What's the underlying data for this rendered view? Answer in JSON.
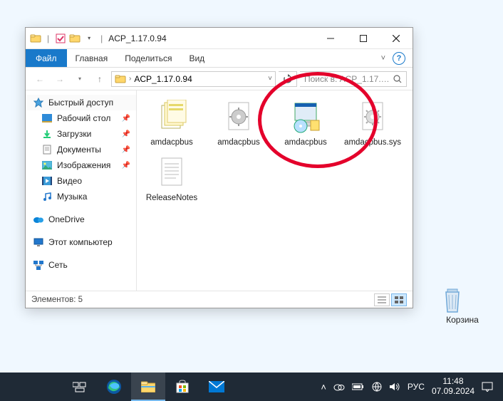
{
  "window": {
    "title": "ACP_1.17.0.94"
  },
  "ribbon": {
    "file": "Файл",
    "tabs": [
      "Главная",
      "Поделиться",
      "Вид"
    ]
  },
  "address": {
    "path_segment": "ACP_1.17.0.94",
    "search_placeholder": "Поиск в: ACP_1.17.0.94"
  },
  "nav": {
    "quick_access": "Быстрый доступ",
    "items": [
      {
        "label": "Рабочий стол",
        "pinned": true
      },
      {
        "label": "Загрузки",
        "pinned": true
      },
      {
        "label": "Документы",
        "pinned": true
      },
      {
        "label": "Изображения",
        "pinned": true
      },
      {
        "label": "Видео",
        "pinned": false
      },
      {
        "label": "Музыка",
        "pinned": false
      }
    ],
    "onedrive": "OneDrive",
    "this_pc": "Этот компьютер",
    "network": "Сеть"
  },
  "files": [
    {
      "name": "amdacpbus",
      "kind": "catalog"
    },
    {
      "name": "amdacpbus",
      "kind": "inf"
    },
    {
      "name": "amdacpbus",
      "kind": "installer"
    },
    {
      "name": "amdacpbus.sys",
      "kind": "sys"
    },
    {
      "name": "ReleaseNotes",
      "kind": "text"
    }
  ],
  "status": {
    "count_label": "Элементов: 5"
  },
  "desktop": {
    "recycle_bin": "Корзина"
  },
  "taskbar": {
    "lang": "РУС",
    "time": "11:48",
    "date": "07.09.2024"
  }
}
